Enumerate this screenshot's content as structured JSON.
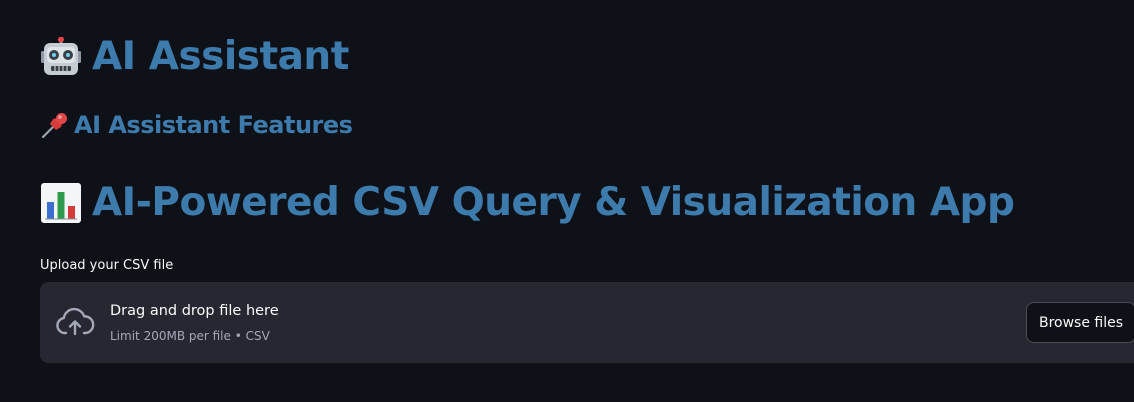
{
  "header": {
    "title": "AI Assistant",
    "title_icon": "robot-emoji-icon"
  },
  "features": {
    "heading": "AI Assistant Features",
    "heading_icon": "pushpin-emoji-icon"
  },
  "app": {
    "heading": "AI-Powered CSV Query & Visualization App",
    "heading_icon": "bar-chart-emoji-icon"
  },
  "uploader": {
    "label": "Upload your CSV file",
    "primary_text": "Drag and drop file here",
    "secondary_text": "Limit 200MB per file • CSV",
    "upload_icon": "cloud-upload-icon",
    "browse_label": "Browse files"
  },
  "colors": {
    "background": "#0e1117",
    "heading": "#3d7bad",
    "dropzone": "#262730"
  }
}
